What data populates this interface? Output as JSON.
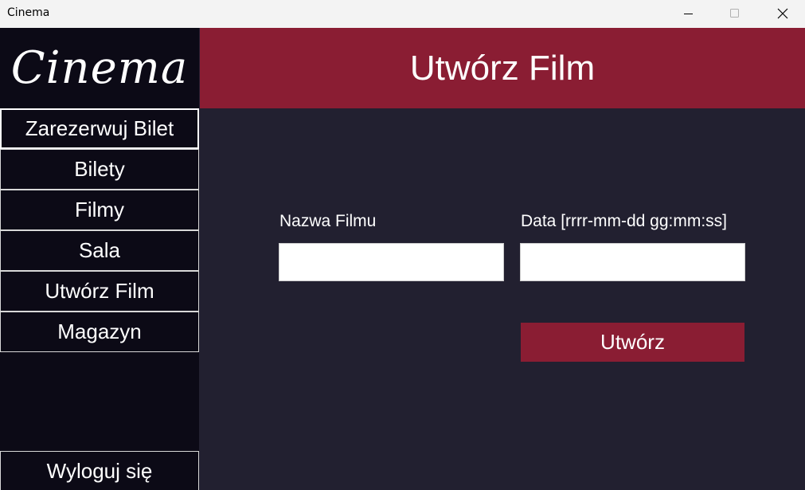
{
  "window": {
    "title": "Cinema",
    "controls": [
      "minimize",
      "maximize",
      "close"
    ]
  },
  "sidebar": {
    "logo": "Cinema",
    "items": [
      {
        "label": "Zarezerwuj Bilet",
        "active": true
      },
      {
        "label": "Bilety",
        "active": false
      },
      {
        "label": "Filmy",
        "active": false
      },
      {
        "label": "Sala",
        "active": false
      },
      {
        "label": "Utwórz Film",
        "active": false
      },
      {
        "label": "Magazyn",
        "active": false
      }
    ],
    "logout_label": "Wyloguj się"
  },
  "header": {
    "title": "Utwórz Film"
  },
  "form": {
    "movie_name_label": "Nazwa Filmu",
    "movie_name_value": "",
    "date_label": "Data [rrrr-mm-dd gg:mm:ss]",
    "date_value": "",
    "submit_label": "Utwórz"
  },
  "colors": {
    "accent": "#8a1d33",
    "sidebar_bg": "#0c0a16",
    "main_bg": "#222030",
    "titlebar_bg": "#f3f3f3"
  }
}
